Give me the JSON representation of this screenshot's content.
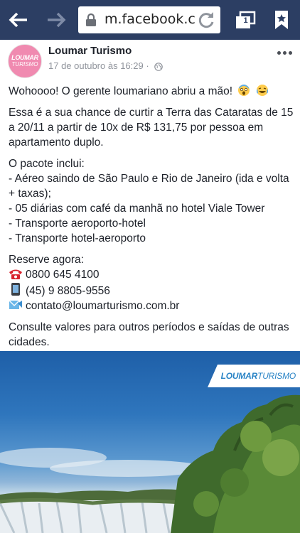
{
  "browser": {
    "url": "m.facebook.c",
    "tab_count": "1"
  },
  "post": {
    "page_name": "Loumar Turismo",
    "avatar_line1": "LOUMAR",
    "avatar_line2": "TURISMO",
    "timestamp": "17 de outubro às 16:29 ·",
    "paragraphs": {
      "p1": "Wohoooo! O gerente loumariano abriu a mão!",
      "p2": "Essa é a sua chance de curtir a Terra das Cataratas de 15 a 20/11 a partir de 10x de R$ 131,75 por pessoa em apartamento duplo.",
      "p3_title": "O pacote inclui:",
      "p3_items": [
        "- Aéreo saindo de São Paulo e Rio de Janeiro (ida e volta + taxas);",
        "- 05 diárias com café da manhã no hotel Viale Tower",
        "- Transporte aeroporto-hotel",
        "- Transporte hotel-aeroporto"
      ],
      "reserve_title": "Reserve agora:",
      "phone": "0800 645 4100",
      "mobile": "(45) 9 8805-9556",
      "email": "contato@loumarturismo.com.br",
      "closing": "Consulte valores para outros períodos e saídas de outras cidades."
    },
    "photo_brand_a": "LOUMAR",
    "photo_brand_b": "TURISMO"
  },
  "colors": {
    "toolbar": "#2c3e63",
    "brand_pink": "#f08ab0",
    "brand_blue": "#2a84c6"
  },
  "icons": [
    "back-arrow-icon",
    "forward-arrow-icon",
    "lock-icon",
    "refresh-icon",
    "tabs-icon",
    "bookmark-icon",
    "globe-icon",
    "more-icon",
    "phone-icon",
    "mobile-icon",
    "email-icon"
  ]
}
